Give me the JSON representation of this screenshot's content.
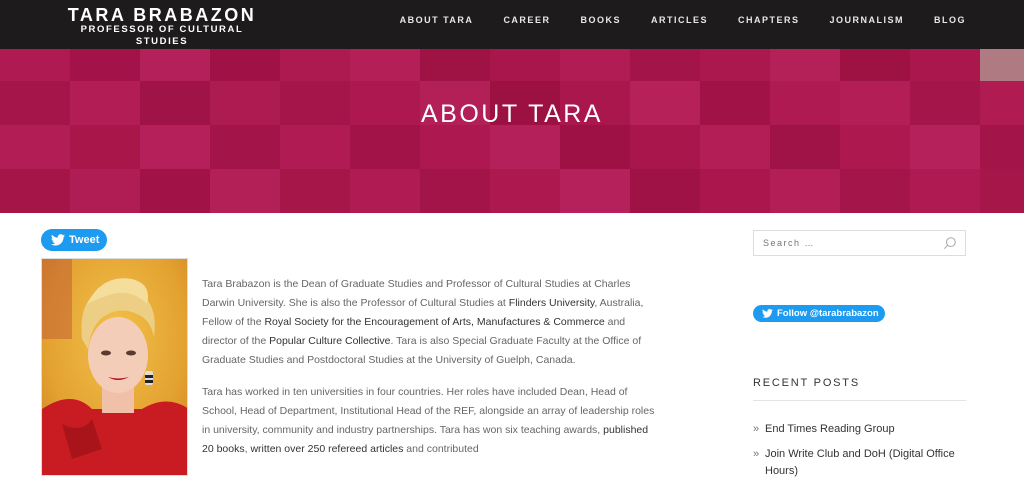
{
  "site": {
    "title": "TARA BRABAZON",
    "tagline": "PROFESSOR OF CULTURAL STUDIES"
  },
  "nav": {
    "items": [
      "ABOUT TARA",
      "CAREER",
      "BOOKS",
      "ARTICLES",
      "CHAPTERS",
      "JOURNALISM",
      "BLOG"
    ]
  },
  "hero": {
    "title": "ABOUT TARA"
  },
  "share": {
    "tweet_label": "Tweet"
  },
  "bio": {
    "p1": [
      "Tara Brabazon is the Dean of Graduate Studies and Professor of Cultural Studies at Charles Darwin University.  She is also the Professor of Cultural Studies at ",
      "Flinders University",
      ", Australia, Fellow of the ",
      "Royal Society for the Encouragement of Arts, Manufactures & Commerce",
      " and director of the ",
      "Popular Culture Collective",
      ".  Tara is also Special Graduate Faculty at the Office of Graduate Studies and Postdoctoral Studies at the University of Guelph, Canada."
    ],
    "p2": [
      "Tara has worked in ten universities in four countries.  Her roles have included Dean, Head of School, Head of Department, Institutional Head of the REF, alongside an array of leadership roles in university, community and industry partnerships.  Tara has won six teaching awards, ",
      "published 20 books",
      ", ",
      "written over 250 refereed articles",
      " and contributed"
    ]
  },
  "sidebar": {
    "search_placeholder": "Search …",
    "follow_label": "Follow @tarabrabazon",
    "recent_title": "RECENT POSTS",
    "recent_posts": [
      "End Times Reading Group",
      "Join Write Club and DoH (Digital Office Hours)"
    ]
  },
  "colors": {
    "header_bg": "#1e1b1c",
    "hero_bg": "#a8154a",
    "twitter_blue": "#1d9bf0"
  }
}
